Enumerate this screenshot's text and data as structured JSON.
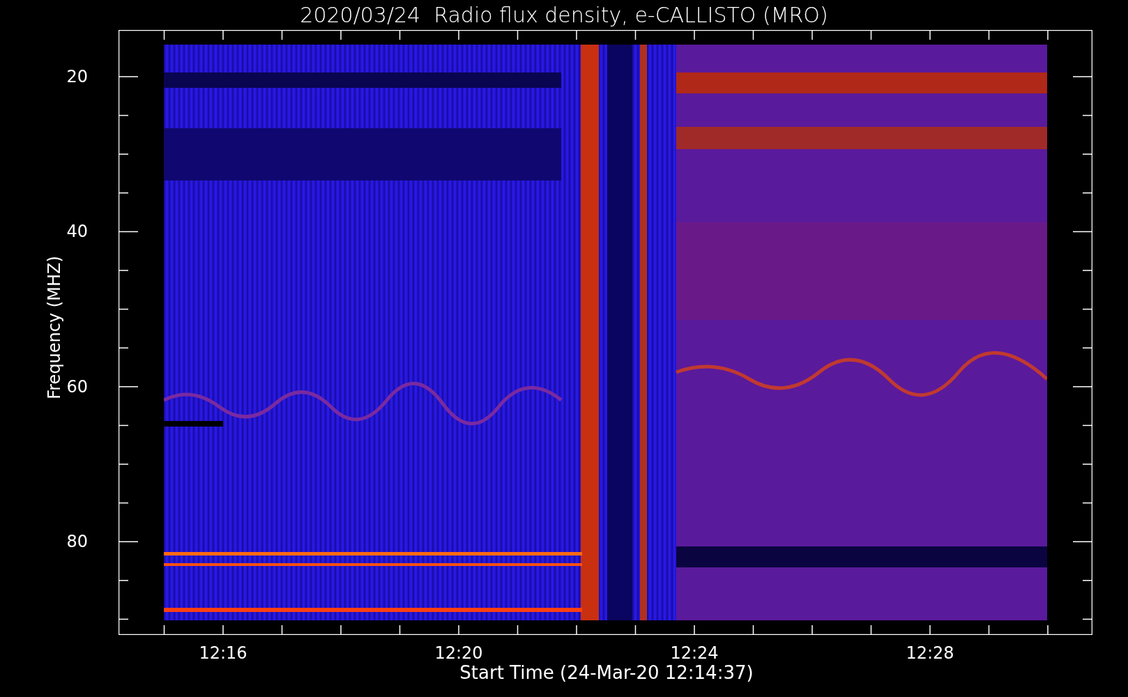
{
  "title": "2020/03/24  Radio flux density, e-CALLISTO (MRO)",
  "ylabel": "Frequency (MHZ)",
  "xlabel": "Start Time (24-Mar-20 12:14:37)",
  "yticks": [
    "20",
    "40",
    "60",
    "80"
  ],
  "xticks": [
    "12:16",
    "12:20",
    "12:24",
    "12:28"
  ]
}
